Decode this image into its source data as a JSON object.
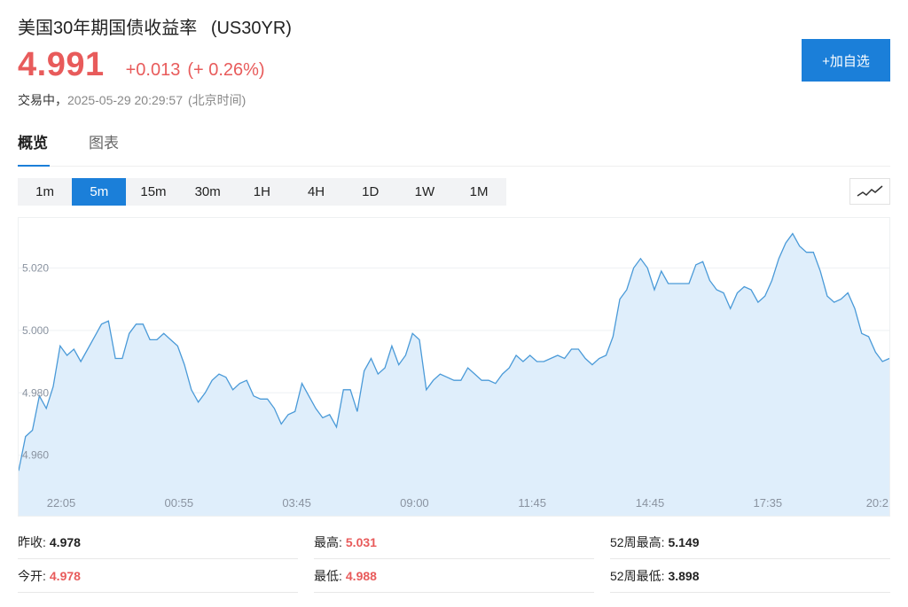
{
  "header": {
    "title": "美国30年期国债收益率",
    "code": "(US30YR)",
    "price": "4.991",
    "change": "+0.013",
    "change_pct": "(+ 0.26%)",
    "status": "交易中，",
    "datetime": "2025-05-29 20:29:57",
    "timezone": "(北京时间)",
    "add_button": "+加自选"
  },
  "tabs": [
    {
      "label": "概览",
      "active": true
    },
    {
      "label": "图表",
      "active": false
    }
  ],
  "intervals": [
    {
      "label": "1m",
      "active": false
    },
    {
      "label": "5m",
      "active": true
    },
    {
      "label": "15m",
      "active": false
    },
    {
      "label": "30m",
      "active": false
    },
    {
      "label": "1H",
      "active": false
    },
    {
      "label": "4H",
      "active": false
    },
    {
      "label": "1D",
      "active": false
    },
    {
      "label": "1W",
      "active": false
    },
    {
      "label": "1M",
      "active": false
    }
  ],
  "chart_type_icon": "line-chart-icon",
  "colors": {
    "accent": "#1b7fd9",
    "up": "#e85b5b",
    "line": "#4a9ad8",
    "fill": "#dfeefb"
  },
  "chart_data": {
    "type": "area",
    "ylim": [
      4.948,
      5.036
    ],
    "y_ticks": [
      "4.960",
      "4.980",
      "5.000",
      "5.020"
    ],
    "x_ticks": [
      "22:05",
      "00:55",
      "03:45",
      "09:00",
      "11:45",
      "14:45",
      "17:35",
      "20:2"
    ],
    "grid": true,
    "values": [
      4.955,
      4.966,
      4.968,
      4.979,
      4.975,
      4.982,
      4.995,
      4.992,
      4.994,
      4.99,
      4.994,
      4.998,
      5.002,
      5.003,
      4.991,
      4.991,
      4.999,
      5.002,
      5.002,
      4.997,
      4.997,
      4.999,
      4.997,
      4.995,
      4.989,
      4.981,
      4.977,
      4.98,
      4.984,
      4.986,
      4.985,
      4.981,
      4.983,
      4.984,
      4.979,
      4.978,
      4.978,
      4.975,
      4.97,
      4.973,
      4.974,
      4.983,
      4.979,
      4.975,
      4.972,
      4.973,
      4.969,
      4.981,
      4.981,
      4.974,
      4.987,
      4.991,
      4.986,
      4.988,
      4.995,
      4.989,
      4.992,
      4.999,
      4.997,
      4.981,
      4.984,
      4.986,
      4.985,
      4.984,
      4.984,
      4.988,
      4.986,
      4.984,
      4.984,
      4.983,
      4.986,
      4.988,
      4.992,
      4.99,
      4.992,
      4.99,
      4.99,
      4.991,
      4.992,
      4.991,
      4.994,
      4.994,
      4.991,
      4.989,
      4.991,
      4.992,
      4.998,
      5.01,
      5.013,
      5.02,
      5.023,
      5.02,
      5.013,
      5.019,
      5.015,
      5.015,
      5.015,
      5.015,
      5.021,
      5.022,
      5.016,
      5.013,
      5.012,
      5.007,
      5.012,
      5.014,
      5.013,
      5.009,
      5.011,
      5.016,
      5.023,
      5.028,
      5.031,
      5.027,
      5.025,
      5.025,
      5.019,
      5.011,
      5.009,
      5.01,
      5.012,
      5.007,
      4.999,
      4.998,
      4.993,
      4.99,
      4.991
    ]
  },
  "stats": [
    [
      {
        "label": "昨收:",
        "value": "4.978",
        "red": false
      },
      {
        "label": "最高:",
        "value": "5.031",
        "red": true
      },
      {
        "label": "52周最高:",
        "value": "5.149",
        "red": false
      }
    ],
    [
      {
        "label": "今开:",
        "value": "4.978",
        "red": true
      },
      {
        "label": "最低:",
        "value": "4.988",
        "red": true
      },
      {
        "label": "52周最低:",
        "value": "3.898",
        "red": false
      }
    ]
  ]
}
